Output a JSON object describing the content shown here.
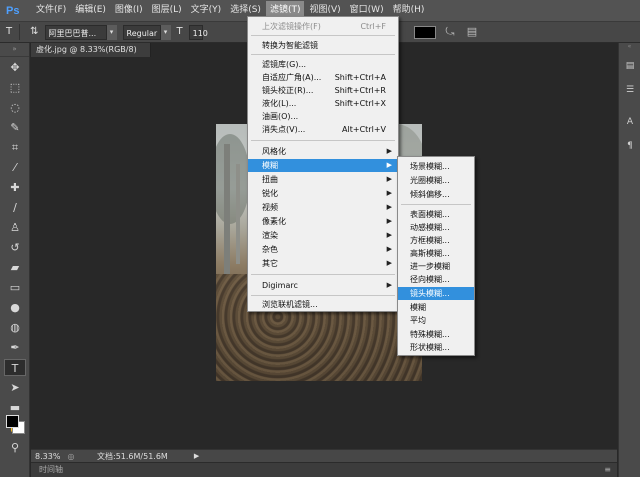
{
  "app": {
    "logo": "Ps"
  },
  "menubar": {
    "items": [
      "文件(F)",
      "编辑(E)",
      "图像(I)",
      "图层(L)",
      "文字(Y)",
      "选择(S)",
      "滤镜(T)",
      "视图(V)",
      "窗口(W)",
      "帮助(H)"
    ],
    "active_index": 6
  },
  "options": {
    "tool_glyph": "T",
    "font_family": "阿里巴巴普...",
    "font_style": "Regular",
    "font_size": "110",
    "color_swatch": "#000000"
  },
  "document": {
    "tab_title": "虚化.jpg @ 8.33%(RGB/8) *",
    "close_glyph": "×"
  },
  "status": {
    "zoom": "8.33%",
    "doc_info": "文档:51.6M/51.6M",
    "timeline_label": "时间轴"
  },
  "filter_menu": {
    "last_filter": {
      "label": "上次滤镜操作(F)",
      "shortcut": "Ctrl+F"
    },
    "convert_smart": "转换为智能滤镜",
    "items_top": [
      {
        "label": "滤镜库(G)...",
        "shortcut": ""
      },
      {
        "label": "自适应广角(A)...",
        "shortcut": "Shift+Ctrl+A"
      },
      {
        "label": "镜头校正(R)...",
        "shortcut": "Shift+Ctrl+R"
      },
      {
        "label": "液化(L)...",
        "shortcut": "Shift+Ctrl+X"
      },
      {
        "label": "油画(O)...",
        "shortcut": ""
      },
      {
        "label": "消失点(V)...",
        "shortcut": "Alt+Ctrl+V"
      }
    ],
    "submenus": [
      "风格化",
      "模糊",
      "扭曲",
      "锐化",
      "视频",
      "像素化",
      "渲染",
      "杂色",
      "其它"
    ],
    "highlighted_submenu": "模糊",
    "digimarc": "Digimarc",
    "browse_online": "浏览联机滤镜..."
  },
  "blur_menu": {
    "group1": [
      "场景模糊...",
      "光圈模糊...",
      "倾斜偏移..."
    ],
    "group2": [
      "表面模糊...",
      "动感模糊...",
      "方框模糊...",
      "高斯模糊...",
      "进一步模糊",
      "径向模糊...",
      "镜头模糊...",
      "模糊",
      "平均",
      "特殊模糊...",
      "形状模糊..."
    ],
    "highlighted": "镜头模糊..."
  }
}
